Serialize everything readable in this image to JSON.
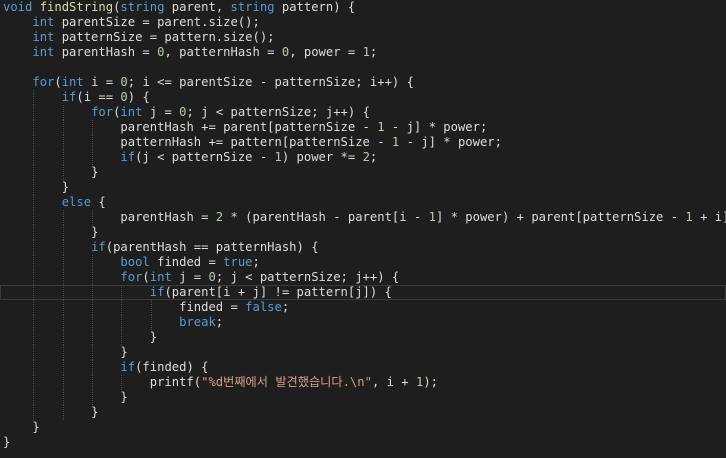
{
  "theme": {
    "background": "#1e1e1e",
    "keyword": "#569cd6",
    "function": "#dcdcaa",
    "number": "#b5cea8",
    "string": "#d69d85",
    "text": "#dcdcdc"
  },
  "editor": {
    "current_line": 19,
    "lines": [
      {
        "indent": 0,
        "tokens": [
          [
            "kw",
            "void"
          ],
          [
            "plain",
            " "
          ],
          [
            "fn",
            "findString"
          ],
          [
            "plain",
            "("
          ],
          [
            "kw",
            "string"
          ],
          [
            "plain",
            " parent, "
          ],
          [
            "kw",
            "string"
          ],
          [
            "plain",
            " pattern) {"
          ]
        ]
      },
      {
        "indent": 1,
        "tokens": [
          [
            "kw",
            "int"
          ],
          [
            "plain",
            " parentSize = parent.size();"
          ]
        ]
      },
      {
        "indent": 1,
        "tokens": [
          [
            "kw",
            "int"
          ],
          [
            "plain",
            " patternSize = pattern.size();"
          ]
        ]
      },
      {
        "indent": 1,
        "tokens": [
          [
            "kw",
            "int"
          ],
          [
            "plain",
            " parentHash = "
          ],
          [
            "num",
            "0"
          ],
          [
            "plain",
            ", patternHash = "
          ],
          [
            "num",
            "0"
          ],
          [
            "plain",
            ", power = "
          ],
          [
            "num",
            "1"
          ],
          [
            "plain",
            ";"
          ]
        ]
      },
      {
        "indent": 0,
        "tokens": []
      },
      {
        "indent": 1,
        "tokens": [
          [
            "kw",
            "for"
          ],
          [
            "plain",
            "("
          ],
          [
            "kw",
            "int"
          ],
          [
            "plain",
            " i = "
          ],
          [
            "num",
            "0"
          ],
          [
            "plain",
            "; i <= parentSize - patternSize; i++) {"
          ]
        ]
      },
      {
        "indent": 2,
        "tokens": [
          [
            "kw",
            "if"
          ],
          [
            "plain",
            "(i == "
          ],
          [
            "num",
            "0"
          ],
          [
            "plain",
            ") {"
          ]
        ]
      },
      {
        "indent": 3,
        "tokens": [
          [
            "kw",
            "for"
          ],
          [
            "plain",
            "("
          ],
          [
            "kw",
            "int"
          ],
          [
            "plain",
            " j = "
          ],
          [
            "num",
            "0"
          ],
          [
            "plain",
            "; j < patternSize; j++) {"
          ]
        ]
      },
      {
        "indent": 4,
        "tokens": [
          [
            "plain",
            "parentHash += parent[patternSize - "
          ],
          [
            "num",
            "1"
          ],
          [
            "plain",
            " - j] * power;"
          ]
        ]
      },
      {
        "indent": 4,
        "tokens": [
          [
            "plain",
            "patternHash += pattern[patternSize - "
          ],
          [
            "num",
            "1"
          ],
          [
            "plain",
            " - j] * power;"
          ]
        ]
      },
      {
        "indent": 4,
        "tokens": [
          [
            "kw",
            "if"
          ],
          [
            "plain",
            "(j < patternSize - "
          ],
          [
            "num",
            "1"
          ],
          [
            "plain",
            ") power *= "
          ],
          [
            "num",
            "2"
          ],
          [
            "plain",
            ";"
          ]
        ]
      },
      {
        "indent": 3,
        "tokens": [
          [
            "plain",
            "}"
          ]
        ]
      },
      {
        "indent": 2,
        "tokens": [
          [
            "plain",
            "}"
          ]
        ]
      },
      {
        "indent": 2,
        "tokens": [
          [
            "kw",
            "else"
          ],
          [
            "plain",
            " {"
          ]
        ]
      },
      {
        "indent": 4,
        "tokens": [
          [
            "plain",
            "parentHash = "
          ],
          [
            "num",
            "2"
          ],
          [
            "plain",
            " * (parentHash - parent[i - "
          ],
          [
            "num",
            "1"
          ],
          [
            "plain",
            "] * power) + parent[patternSize - "
          ],
          [
            "num",
            "1"
          ],
          [
            "plain",
            " + i];"
          ]
        ]
      },
      {
        "indent": 3,
        "tokens": [
          [
            "plain",
            "}"
          ]
        ]
      },
      {
        "indent": 3,
        "tokens": [
          [
            "kw",
            "if"
          ],
          [
            "plain",
            "(parentHash == patternHash) {"
          ]
        ]
      },
      {
        "indent": 4,
        "tokens": [
          [
            "kw",
            "bool"
          ],
          [
            "plain",
            " finded = "
          ],
          [
            "kw",
            "true"
          ],
          [
            "plain",
            ";"
          ]
        ]
      },
      {
        "indent": 4,
        "tokens": [
          [
            "kw",
            "for"
          ],
          [
            "plain",
            "("
          ],
          [
            "kw",
            "int"
          ],
          [
            "plain",
            " j = "
          ],
          [
            "num",
            "0"
          ],
          [
            "plain",
            "; j < patternSize; j++) {"
          ]
        ]
      },
      {
        "indent": 5,
        "tokens": [
          [
            "kw",
            "if"
          ],
          [
            "plain",
            "(parent[i + j] != pattern[j]) {"
          ]
        ]
      },
      {
        "indent": 6,
        "tokens": [
          [
            "plain",
            "finded = "
          ],
          [
            "kw",
            "false"
          ],
          [
            "plain",
            ";"
          ]
        ]
      },
      {
        "indent": 6,
        "tokens": [
          [
            "kw",
            "break"
          ],
          [
            "plain",
            ";"
          ]
        ]
      },
      {
        "indent": 5,
        "tokens": [
          [
            "plain",
            "}"
          ]
        ]
      },
      {
        "indent": 4,
        "tokens": [
          [
            "plain",
            "}"
          ]
        ]
      },
      {
        "indent": 4,
        "tokens": [
          [
            "kw",
            "if"
          ],
          [
            "plain",
            "(finded) {"
          ]
        ]
      },
      {
        "indent": 5,
        "tokens": [
          [
            "plain",
            "printf("
          ],
          [
            "str",
            "\"%d번째에서 발견했습니다.\\n\""
          ],
          [
            "plain",
            ", i + "
          ],
          [
            "num",
            "1"
          ],
          [
            "plain",
            ");"
          ]
        ]
      },
      {
        "indent": 4,
        "tokens": [
          [
            "plain",
            "}"
          ]
        ]
      },
      {
        "indent": 3,
        "tokens": [
          [
            "plain",
            "}"
          ]
        ]
      },
      {
        "indent": 1,
        "tokens": [
          [
            "plain",
            "}"
          ]
        ]
      },
      {
        "indent": 0,
        "tokens": [
          [
            "plain",
            "}"
          ]
        ]
      }
    ],
    "guides": [
      [],
      [],
      [],
      [],
      [],
      [],
      [
        1
      ],
      [
        1,
        2
      ],
      [
        1,
        2,
        3
      ],
      [
        1,
        2,
        3
      ],
      [
        1,
        2,
        3
      ],
      [
        1,
        2
      ],
      [
        1
      ],
      [
        1
      ],
      [
        1,
        2,
        3
      ],
      [
        1,
        2
      ],
      [
        1,
        2
      ],
      [
        1,
        2,
        3
      ],
      [
        1,
        2,
        3
      ],
      [
        1,
        2,
        3,
        4
      ],
      [
        1,
        2,
        3,
        4,
        5
      ],
      [
        1,
        2,
        3,
        4,
        5
      ],
      [
        1,
        2,
        3,
        4
      ],
      [
        1,
        2,
        3
      ],
      [
        1,
        2,
        3
      ],
      [
        1,
        2,
        3,
        4
      ],
      [
        1,
        2,
        3
      ],
      [
        1,
        2
      ],
      [],
      []
    ]
  }
}
